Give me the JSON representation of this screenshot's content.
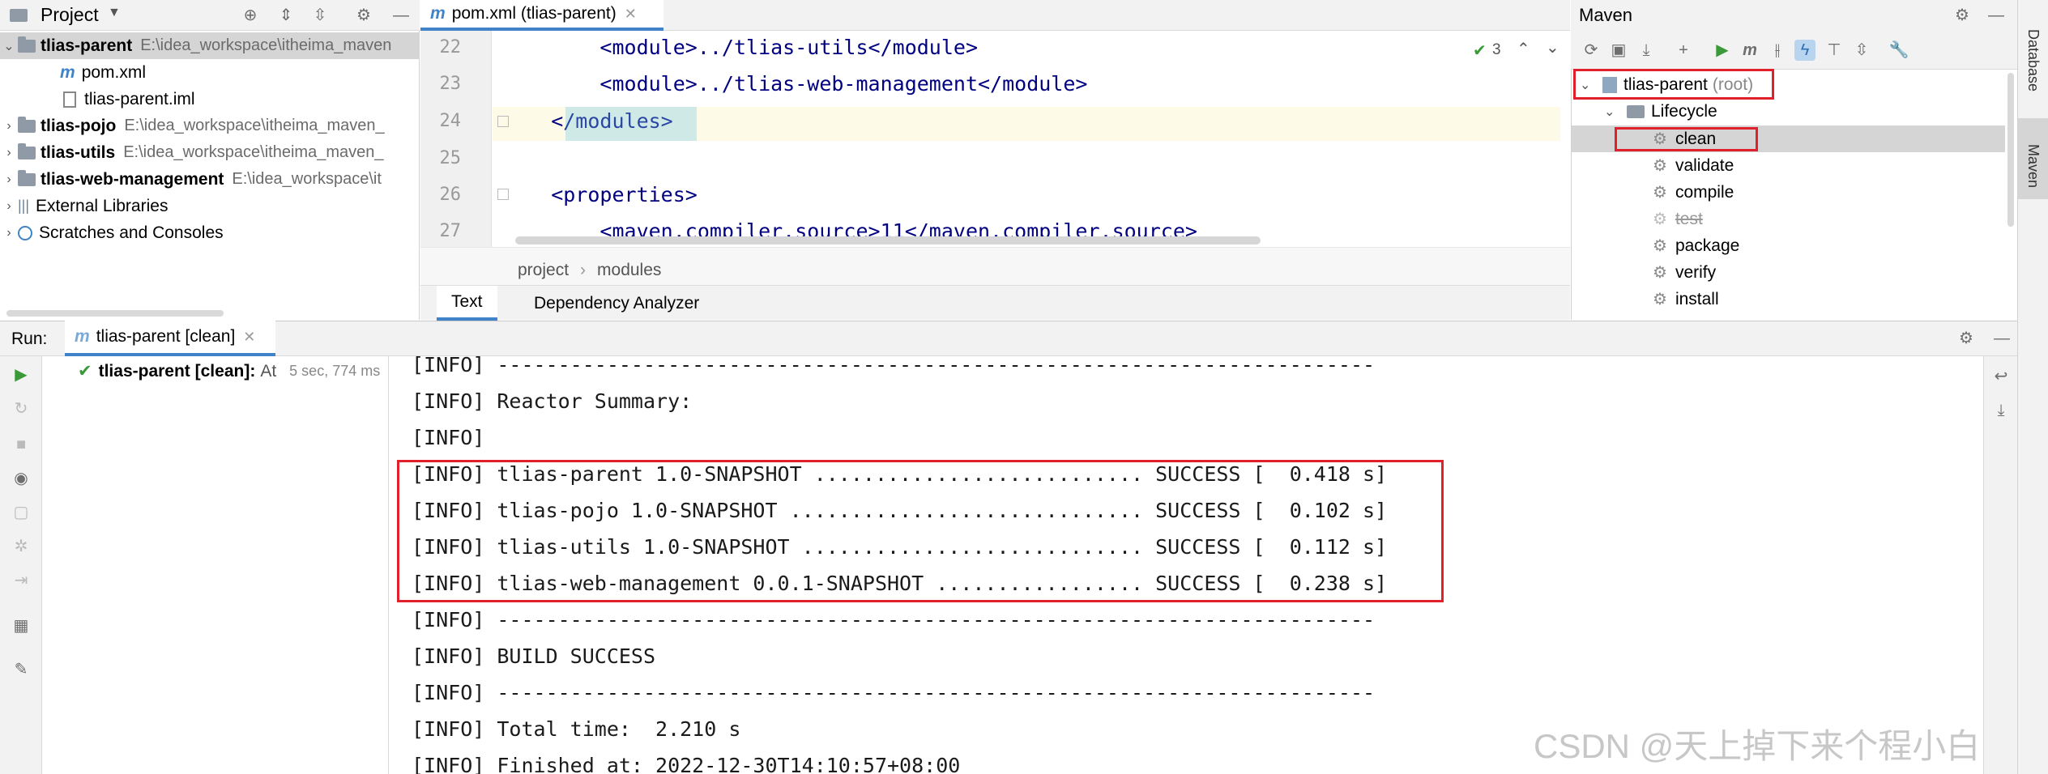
{
  "project_panel": {
    "title": "Project",
    "tree": [
      {
        "label": "tlias-parent",
        "path": "E:\\idea_workspace\\itheima_maven",
        "bold": true,
        "expanded": true
      },
      {
        "label": "pom.xml",
        "path": ""
      },
      {
        "label": "tlias-parent.iml",
        "path": ""
      },
      {
        "label": "tlias-pojo",
        "path": "E:\\idea_workspace\\itheima_maven_",
        "bold": true
      },
      {
        "label": "tlias-utils",
        "path": "E:\\idea_workspace\\itheima_maven_",
        "bold": true
      },
      {
        "label": "tlias-web-management",
        "path": "E:\\idea_workspace\\it",
        "bold": true
      },
      {
        "label": "External Libraries",
        "path": ""
      },
      {
        "label": "Scratches and Consoles",
        "path": ""
      }
    ]
  },
  "editor": {
    "tab_label": "pom.xml (tlias-parent)",
    "inspection_count": "3",
    "lines": [
      {
        "num": "22",
        "code": "        <module>../tlias-utils</module>"
      },
      {
        "num": "23",
        "code": "        <module>../tlias-web-management</module>"
      },
      {
        "num": "24",
        "code": "    </modules>"
      },
      {
        "num": "25",
        "code": ""
      },
      {
        "num": "26",
        "code": "    <properties>"
      },
      {
        "num": "27",
        "code": "        <maven.compiler.source>11</maven.compiler.source>"
      }
    ],
    "breadcrumb": [
      "project",
      "modules"
    ],
    "bottom_tabs": [
      "Text",
      "Dependency Analyzer"
    ]
  },
  "maven_panel": {
    "title": "Maven",
    "root": "tlias-parent",
    "root_suffix": "(root)",
    "lifecycle_label": "Lifecycle",
    "phases": [
      "clean",
      "validate",
      "compile",
      "test",
      "package",
      "verify",
      "install"
    ],
    "selected_phase": "clean"
  },
  "right_strip": {
    "database_label": "Database",
    "maven_label": "Maven"
  },
  "run_panel": {
    "label": "Run:",
    "tab_label": "tlias-parent [clean]",
    "tree_item": "tlias-parent [clean]:",
    "tree_item_suffix": "At",
    "tree_item_time": "5 sec, 774 ms",
    "console_lines": [
      "[INFO] ------------------------------------------------------------------------",
      "[INFO] Reactor Summary:",
      "[INFO]",
      "[INFO] tlias-parent 1.0-SNAPSHOT ........................... SUCCESS [  0.418 s]",
      "[INFO] tlias-pojo 1.0-SNAPSHOT ............................. SUCCESS [  0.102 s]",
      "[INFO] tlias-utils 1.0-SNAPSHOT ............................ SUCCESS [  0.112 s]",
      "[INFO] tlias-web-management 0.0.1-SNAPSHOT ................. SUCCESS [  0.238 s]",
      "[INFO] ------------------------------------------------------------------------",
      "[INFO] BUILD SUCCESS",
      "[INFO] ------------------------------------------------------------------------",
      "[INFO] Total time:  2.210 s",
      "[INFO] Finished at: 2022-12-30T14:10:57+08:00"
    ]
  },
  "watermark": "CSDN @天上掉下来个程小白",
  "colors": {
    "accent": "#4083c9",
    "highlight_red": "#e0202b",
    "selection": "#d5d5d5"
  }
}
